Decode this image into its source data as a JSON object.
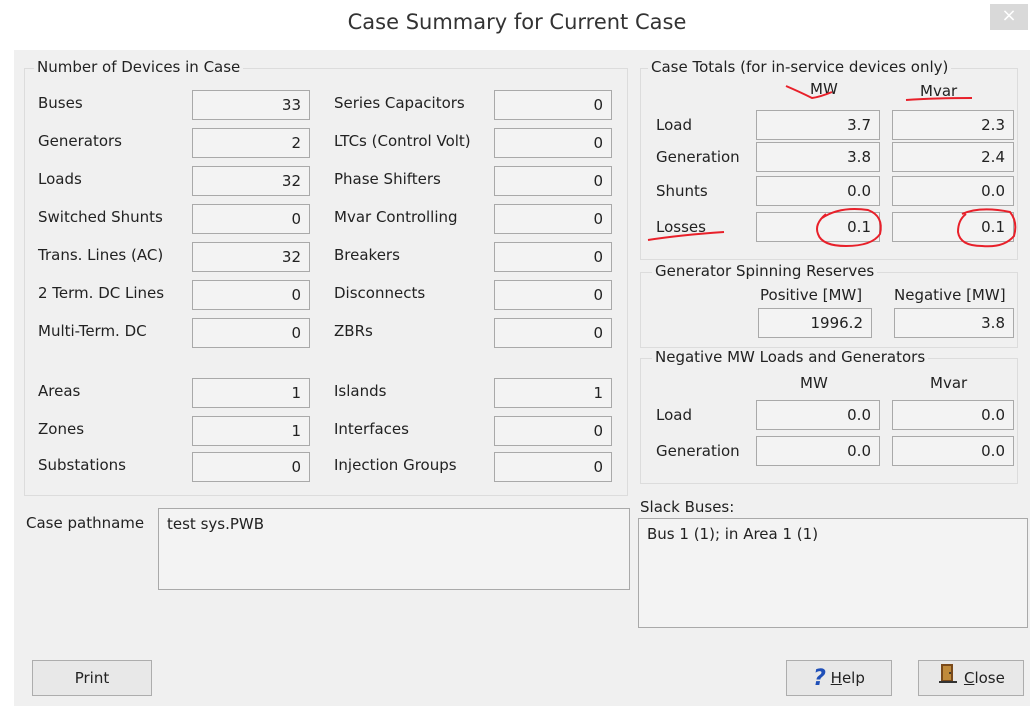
{
  "window": {
    "title": "Case Summary for Current Case",
    "close_glyph": "×"
  },
  "devices": {
    "title": "Number of Devices in Case",
    "left": [
      {
        "label": "Buses",
        "value": "33"
      },
      {
        "label": "Generators",
        "value": "2"
      },
      {
        "label": "Loads",
        "value": "32"
      },
      {
        "label": "Switched Shunts",
        "value": "0"
      },
      {
        "label": "Trans. Lines (AC)",
        "value": "32"
      },
      {
        "label": "2 Term. DC Lines",
        "value": "0"
      },
      {
        "label": "Multi-Term. DC",
        "value": "0"
      },
      {
        "label": "Areas",
        "value": "1"
      },
      {
        "label": "Zones",
        "value": "1"
      },
      {
        "label": "Substations",
        "value": "0"
      }
    ],
    "right": [
      {
        "label": "Series Capacitors",
        "value": "0"
      },
      {
        "label": "LTCs (Control Volt)",
        "value": "0"
      },
      {
        "label": "Phase Shifters",
        "value": "0"
      },
      {
        "label": "Mvar Controlling",
        "value": "0"
      },
      {
        "label": "Breakers",
        "value": "0"
      },
      {
        "label": "Disconnects",
        "value": "0"
      },
      {
        "label": "ZBRs",
        "value": "0"
      },
      {
        "label": "Islands",
        "value": "1"
      },
      {
        "label": "Interfaces",
        "value": "0"
      },
      {
        "label": "Injection Groups",
        "value": "0"
      }
    ]
  },
  "totals": {
    "title": "Case Totals (for in-service devices only)",
    "col_mw": "MW",
    "col_mvar": "Mvar",
    "rows": [
      {
        "label": "Load",
        "mw": "3.7",
        "mvar": "2.3"
      },
      {
        "label": "Generation",
        "mw": "3.8",
        "mvar": "2.4"
      },
      {
        "label": "Shunts",
        "mw": "0.0",
        "mvar": "0.0"
      },
      {
        "label": "Losses",
        "mw": "0.1",
        "mvar": "0.1"
      }
    ],
    "annotation_color": "#e8202a"
  },
  "reserves": {
    "title": "Generator Spinning Reserves",
    "pos_label": "Positive [MW]",
    "neg_label": "Negative [MW]",
    "pos_value": "1996.2",
    "neg_value": "3.8"
  },
  "negative": {
    "title": "Negative MW Loads and Generators",
    "col_mw": "MW",
    "col_mvar": "Mvar",
    "rows": [
      {
        "label": "Load",
        "mw": "0.0",
        "mvar": "0.0"
      },
      {
        "label": "Generation",
        "mw": "0.0",
        "mvar": "0.0"
      }
    ]
  },
  "case_pathname": {
    "label": "Case pathname",
    "value": "test sys.PWB"
  },
  "slack": {
    "label": "Slack Buses:",
    "value": "Bus 1 (1); in Area 1 (1)"
  },
  "buttons": {
    "print": "Print",
    "help_mnemonic": "H",
    "help_rest": "elp",
    "close_mnemonic": "C",
    "close_rest": "lose"
  },
  "icons": {
    "help": "question-mark-icon",
    "close": "door-exit-icon"
  }
}
